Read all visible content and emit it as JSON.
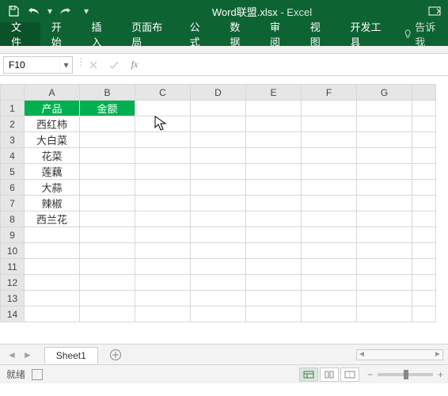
{
  "title": {
    "filename": "Word联盟.xlsx",
    "app": "Excel"
  },
  "qat": {
    "save": "save-icon",
    "undo": "undo-icon",
    "redo": "redo-icon",
    "customize": "customize-qat"
  },
  "ribbon_tabs": [
    "文件",
    "开始",
    "插入",
    "页面布局",
    "公式",
    "数据",
    "审阅",
    "视图",
    "开发工具"
  ],
  "tell_me": "告诉我",
  "namebox": {
    "value": "F10"
  },
  "columns": [
    "A",
    "B",
    "C",
    "D",
    "E",
    "F",
    "G"
  ],
  "row_count": 14,
  "header_row": {
    "col_a": "产品",
    "col_b": "金额"
  },
  "data_rows": [
    "西红柿",
    "大白菜",
    "花菜",
    "莲藕",
    "大蒜",
    "辣椒",
    "西兰花"
  ],
  "sheet_tabs": {
    "active": "Sheet1"
  },
  "status": {
    "ready": "就绪"
  },
  "zoom": {
    "level_visible": false
  },
  "colors": {
    "ribbon": "#0e6333",
    "header_fill": "#00b050"
  }
}
